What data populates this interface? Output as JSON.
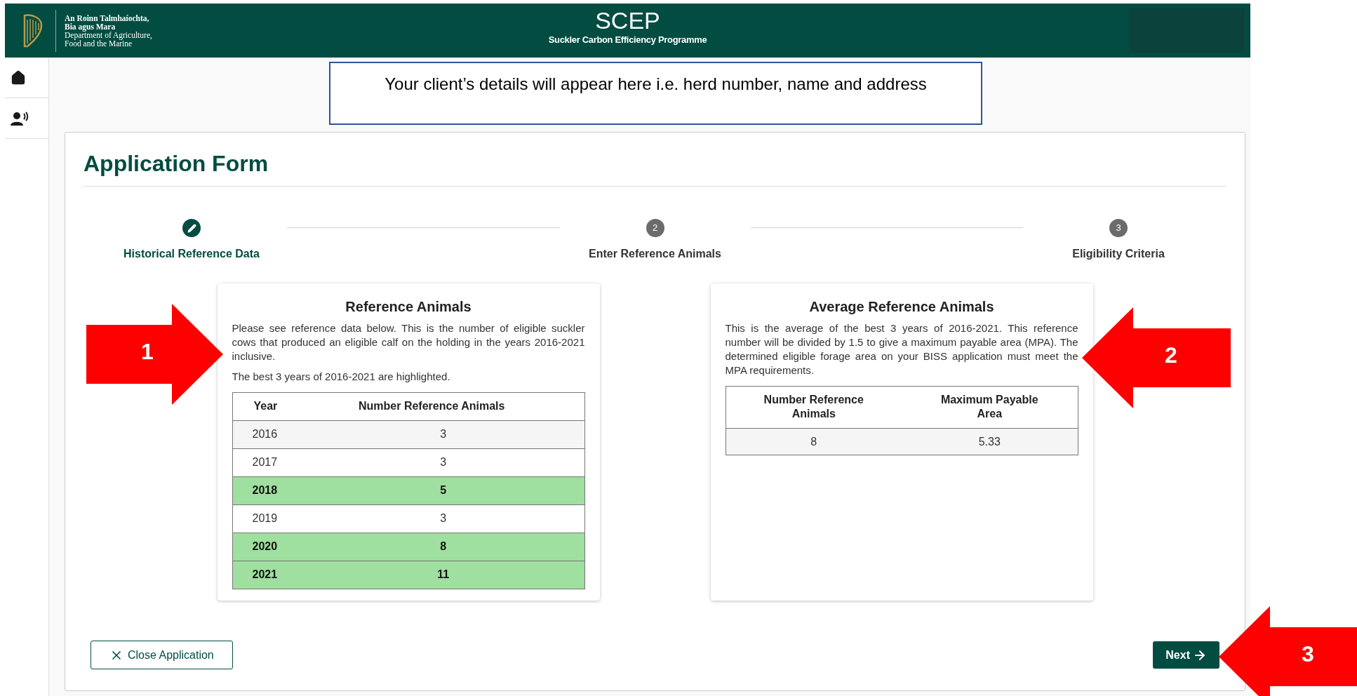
{
  "header": {
    "department_lines": [
      "An Roinn Talmhaíochta,",
      "Bia agus Mara",
      "Department of Agriculture,",
      "Food and the Marine"
    ],
    "title": "SCEP",
    "subtitle": "Suckler Carbon Efficiency Programme"
  },
  "client_notice": "Your client’s details will appear here i.e. herd number, name and address",
  "form": {
    "title": "Application Form",
    "steps": [
      {
        "label": "Historical Reference Data",
        "active": true
      },
      {
        "number": "2",
        "label": "Enter Reference Animals",
        "active": false
      },
      {
        "number": "3",
        "label": "Eligibility Criteria",
        "active": false
      }
    ],
    "reference_card": {
      "title": "Reference Animals",
      "text": "Please see reference data below. This is the number of eligible suckler cows that produced an eligible calf on the holding in the years 2016-2021 inclusive.",
      "note": "The best 3 years of 2016-2021 are highlighted.",
      "columns": [
        "Year",
        "Number Reference Animals"
      ],
      "rows": [
        {
          "year": "2016",
          "count": "3",
          "highlighted": false
        },
        {
          "year": "2017",
          "count": "3",
          "highlighted": false
        },
        {
          "year": "2018",
          "count": "5",
          "highlighted": true
        },
        {
          "year": "2019",
          "count": "3",
          "highlighted": false
        },
        {
          "year": "2020",
          "count": "8",
          "highlighted": true
        },
        {
          "year": "2021",
          "count": "11",
          "highlighted": true
        }
      ]
    },
    "average_card": {
      "title": "Average Reference Animals",
      "text": "This is the average of the best 3 years of 2016-2021. This reference number will be divided by 1.5 to give a maximum payable area (MPA). The determined eligible forage area on your BISS application must meet the MPA requirements.",
      "columns": [
        "Number Reference Animals",
        "Maximum Payable Area"
      ],
      "rows": [
        [
          "8",
          "5.33"
        ]
      ]
    },
    "buttons": {
      "close": "Close Application",
      "next": "Next"
    }
  },
  "callouts": [
    {
      "label": "1",
      "kind": "rightward"
    },
    {
      "label": "2",
      "kind": "leftward"
    },
    {
      "label": "3",
      "kind": "leftward"
    }
  ]
}
